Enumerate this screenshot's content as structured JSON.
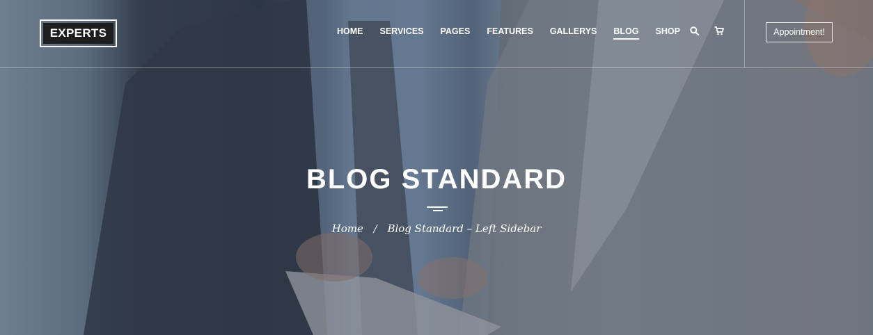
{
  "brand": {
    "logo_text": "EXPERTS"
  },
  "nav": {
    "items": [
      {
        "label": "HOME"
      },
      {
        "label": "SERVICES"
      },
      {
        "label": "PAGES"
      },
      {
        "label": "FEATURES"
      },
      {
        "label": "GALLERYS"
      },
      {
        "label": "BLOG",
        "active": true
      },
      {
        "label": "SHOP"
      }
    ],
    "search_icon": "search-icon",
    "cart_icon": "cart-icon"
  },
  "appointment": {
    "label": "Appointment!"
  },
  "hero": {
    "title": "BLOG STANDARD",
    "breadcrumb": {
      "home": "Home",
      "separator": "/",
      "current": "Blog Standard – Left Sidebar"
    }
  },
  "colors": {
    "text": "#ffffff",
    "logo_bg": "#1e1e1e"
  }
}
